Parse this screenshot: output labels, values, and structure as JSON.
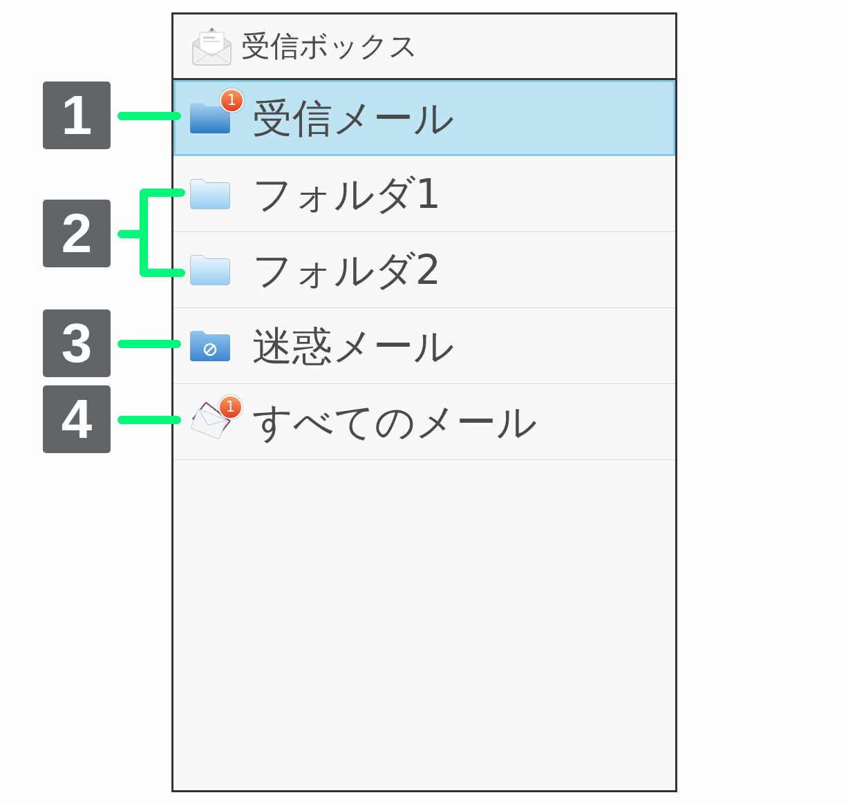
{
  "header": {
    "title": "受信ボックス"
  },
  "folders": [
    {
      "kind": "inbox",
      "label": "受信メール",
      "selected": true,
      "badge": "1"
    },
    {
      "kind": "folder",
      "label": "フォルダ1",
      "selected": false
    },
    {
      "kind": "folder",
      "label": "フォルダ2",
      "selected": false
    },
    {
      "kind": "spam",
      "label": "迷惑メール",
      "selected": false
    },
    {
      "kind": "all",
      "label": "すべてのメール",
      "selected": false,
      "badge": "1"
    }
  ],
  "callouts": [
    {
      "kind": "single",
      "number": "1"
    },
    {
      "kind": "bracket",
      "number": "2"
    },
    {
      "kind": "single",
      "number": "3"
    },
    {
      "kind": "single",
      "number": "4"
    }
  ]
}
